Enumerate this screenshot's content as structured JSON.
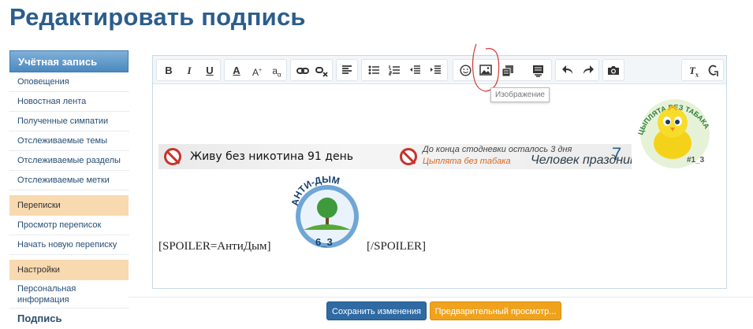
{
  "page": {
    "title": "Редактировать подпись"
  },
  "sidebar": {
    "account_header": "Учётная запись",
    "account_items": [
      "Оповещения",
      "Новостная лента",
      "Полученные симпатии",
      "Отслеживаемые темы",
      "Отслеживаемые разделы",
      "Отслеживаемые метки"
    ],
    "messages_header": "Переписки",
    "messages_items": [
      "Просмотр переписок",
      "Начать новую переписку"
    ],
    "settings_header": "Настройки",
    "settings_items": [
      "Персональная информация"
    ],
    "next_item": "Подпись"
  },
  "toolbar": {
    "buttons": [
      "bold-icon",
      "italic-icon",
      "underline-icon",
      "text-color-icon",
      "font-size-icon",
      "font-family-icon",
      "link-icon",
      "unlink-icon",
      "align-icon",
      "bullet-list-icon",
      "numbered-list-icon",
      "outdent-icon",
      "indent-icon",
      "smilie-icon",
      "image-icon",
      "media-icon",
      "insert-icon",
      "undo-icon",
      "redo-icon",
      "camera-icon",
      "remove-format-icon",
      "toggle-bbcode-icon"
    ],
    "tooltip": "Изображение"
  },
  "content": {
    "banner_line1": "Живу без никотина 91 день",
    "banner_line2": "До конца стодневки осталось 3 дня",
    "banner_line3": "Цыплята без табака",
    "banner_number": "7",
    "banner_line4": "Человек праздник",
    "chick_arc_text": "ЦЫПЛЯТА БЕЗ ТАБАКА",
    "chick_badge": "#1_3",
    "antidym_text": "АНТИ-ДЫМ",
    "antidym_badge": "6_3",
    "spoiler_open": "[SPOILER=АнтиДым]",
    "spoiler_close": "[/SPOILER]"
  },
  "actions": {
    "save_label": "Сохранить изменения",
    "preview_label": "Предварительный просмотр..."
  },
  "colors": {
    "title": "#2b5d8c",
    "save": "#2f6aa3",
    "preview": "#f0a21c",
    "section": "#f9d9b0"
  }
}
